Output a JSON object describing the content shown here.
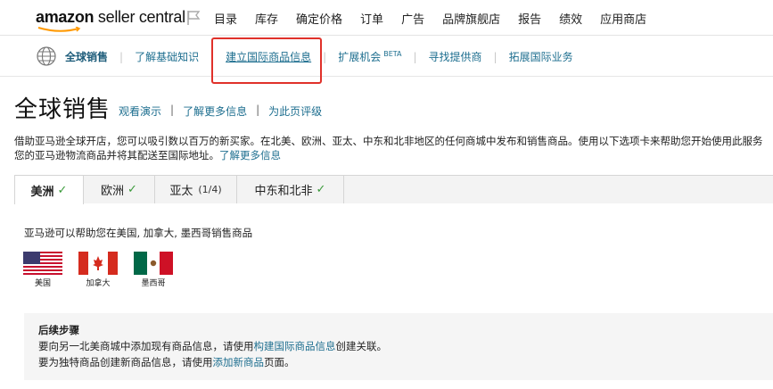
{
  "header": {
    "logo_brand": "amazon",
    "logo_product": "seller central",
    "nav": [
      "目录",
      "库存",
      "确定价格",
      "订单",
      "广告",
      "品牌旗舰店",
      "报告",
      "绩效",
      "应用商店"
    ]
  },
  "subnav": {
    "items": [
      {
        "label": "全球销售",
        "active": true
      },
      {
        "label": "了解基础知识"
      },
      {
        "label": "建立国际商品信息",
        "highlighted": true
      },
      {
        "label": "扩展机会",
        "badge": "BETA"
      },
      {
        "label": "寻找提供商"
      },
      {
        "label": "拓展国际业务"
      }
    ]
  },
  "page": {
    "title": "全球销售",
    "links": [
      "观看演示",
      "了解更多信息",
      "为此页评级"
    ],
    "desc_line1": "借助亚马逊全球开店，您可以吸引数以百万的新买家。在北美、欧洲、亚太、中东和北非地区的任何商城中发布和销售商品。使用以下选项卡来帮助您开始使用此服务",
    "desc_line2": "您的亚马逊物流商品并将其配送至国际地址。",
    "desc_link": "了解更多信息"
  },
  "tabs": [
    {
      "label": "美洲",
      "check": "✓"
    },
    {
      "label": "欧洲",
      "check": "✓"
    },
    {
      "label": "亚太",
      "extra": "(1/4)"
    },
    {
      "label": "中东和北非",
      "check": "✓"
    }
  ],
  "panel": {
    "intro": "亚马逊可以帮助您在美国, 加拿大, 墨西哥销售商品",
    "countries": [
      "美国",
      "加拿大",
      "墨西哥"
    ]
  },
  "next_steps": {
    "heading": "后续步骤",
    "line1_pre": "要向另一北美商城中添加现有商品信息，请使用",
    "line1_link": "构建国际商品信息",
    "line1_post": "创建关联。",
    "line2_pre": "要为独特商品创建新商品信息，请使用",
    "line2_link": "添加新商品",
    "line2_post": "页面。"
  },
  "colors": {
    "link": "#1d6e8f",
    "highlight_box": "#e0312a",
    "check": "#3a9a3a"
  }
}
